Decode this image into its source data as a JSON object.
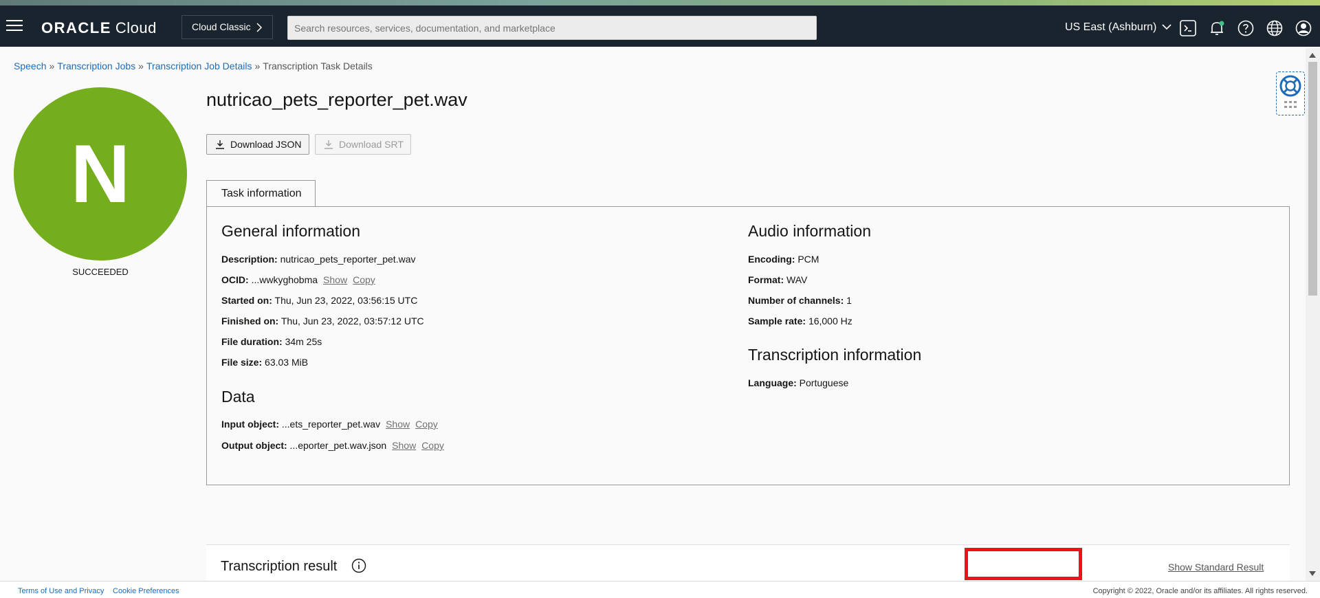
{
  "header": {
    "brand_oracle": "ORACLE",
    "brand_cloud": "Cloud",
    "classic_button": "Cloud Classic",
    "search_placeholder": "Search resources, services, documentation, and marketplace",
    "region": "US East (Ashburn)",
    "icons": [
      "menu-icon",
      "cloud-shell-icon",
      "notifications-icon",
      "help-icon",
      "language-icon",
      "profile-icon"
    ]
  },
  "breadcrumb": {
    "items": [
      "Speech",
      "Transcription Jobs",
      "Transcription Job Details"
    ],
    "current": "Transcription Task Details",
    "separator": "»"
  },
  "avatar": {
    "letter": "N",
    "status": "SUCCEEDED",
    "color": "#74ad1e"
  },
  "page_title": "nutricao_pets_reporter_pet.wav",
  "actions": {
    "download_json": "Download JSON",
    "download_srt": "Download SRT"
  },
  "tabs": {
    "task_information": "Task information"
  },
  "general": {
    "heading": "General information",
    "description_label": "Description:",
    "description_value": "nutricao_pets_reporter_pet.wav",
    "ocid_label": "OCID:",
    "ocid_value": "...wwkyghobma",
    "started_label": "Started on:",
    "started_value": "Thu, Jun 23, 2022, 03:56:15 UTC",
    "finished_label": "Finished on:",
    "finished_value": "Thu, Jun 23, 2022, 03:57:12 UTC",
    "duration_label": "File duration:",
    "duration_value": "34m 25s",
    "size_label": "File size:",
    "size_value": "63.03 MiB"
  },
  "data_section": {
    "heading": "Data",
    "input_label": "Input object:",
    "input_value": "...ets_reporter_pet.wav",
    "output_label": "Output object:",
    "output_value": "...eporter_pet.wav.json"
  },
  "audio": {
    "heading": "Audio information",
    "encoding_label": "Encoding:",
    "encoding_value": "PCM",
    "format_label": "Format:",
    "format_value": "WAV",
    "channels_label": "Number of channels:",
    "channels_value": "1",
    "sample_label": "Sample rate:",
    "sample_value": "16,000 Hz"
  },
  "transcription": {
    "heading": "Transcription information",
    "language_label": "Language:",
    "language_value": "Portuguese"
  },
  "links": {
    "show": "Show",
    "copy": "Copy"
  },
  "result": {
    "title": "Transcription result",
    "show_standard": "Show Standard Result"
  },
  "footer": {
    "terms": "Terms of Use and Privacy",
    "cookies": "Cookie Preferences",
    "copyright": "Copyright © 2022, Oracle and/or its affiliates. All rights reserved."
  },
  "colors": {
    "topbar": "#1a242e",
    "link": "#1e6bb8",
    "highlight": "#e8141c"
  }
}
